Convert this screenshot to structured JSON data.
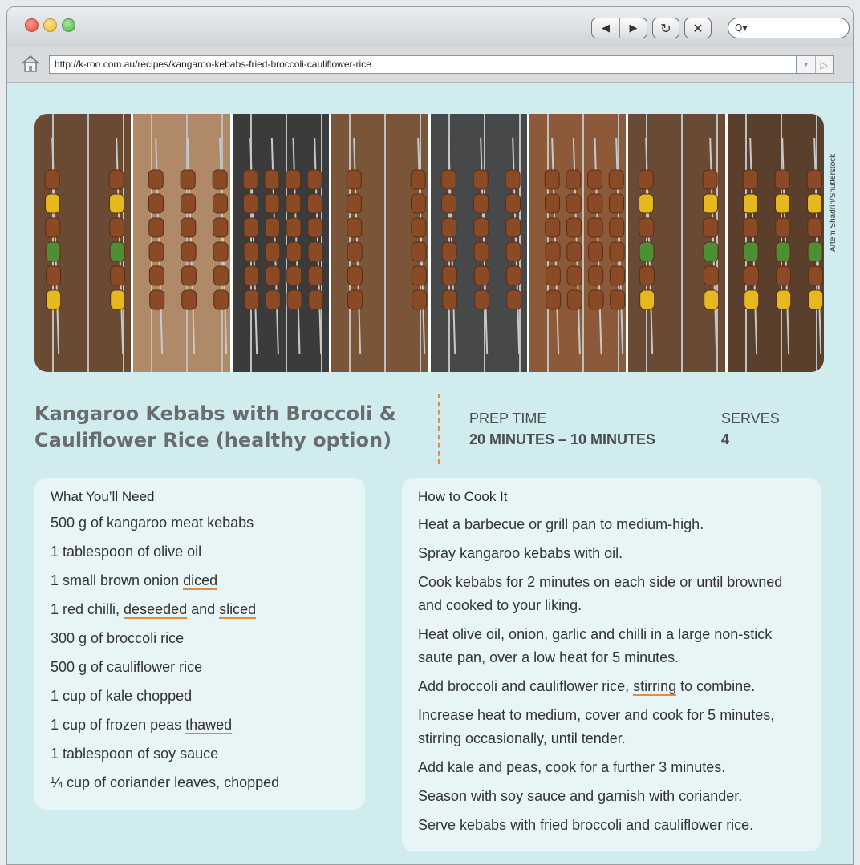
{
  "browser": {
    "url": "http://k-roo.com.au/recipes/kangaroo-kebabs-fried-broccoli-cauliflower-rice",
    "search_placeholder": "Q▾",
    "back_label": "◀",
    "forward_label": "▶",
    "reload_label": "↻",
    "stop_label": "✕",
    "url_dropdown_label": "▾",
    "url_go_label": "▷"
  },
  "banner": {
    "credit": "Artem Shadrin/Shutterstock",
    "panel_colors": [
      "#6b4a33",
      "#b08a68",
      "#3c3b3b",
      "#7a5538",
      "#46484a",
      "#8c5a38",
      "#6a4a34",
      "#5a3f2d"
    ]
  },
  "recipe": {
    "title": "Kangaroo Kebabs with Broccoli & Cauliflower Rice (healthy option)",
    "prep_label": "PREP TIME",
    "prep_value": "20 MINUTES – 10 MINUTES",
    "serves_label": "SERVES",
    "serves_value": "4"
  },
  "ingredients": {
    "heading": "What You’ll Need",
    "items": [
      [
        {
          "t": "500 g of kangaroo meat kebabs"
        }
      ],
      [
        {
          "t": "1 tablespoon of olive oil"
        }
      ],
      [
        {
          "t": "1 small brown onion "
        },
        {
          "t": "diced",
          "u": true
        }
      ],
      [
        {
          "t": "1 red chilli, "
        },
        {
          "t": "deseeded",
          "u": true
        },
        {
          "t": " and "
        },
        {
          "t": "sliced",
          "u": true
        }
      ],
      [
        {
          "t": "300 g of broccoli rice"
        }
      ],
      [
        {
          "t": "500 g of cauliflower rice"
        }
      ],
      [
        {
          "t": "1 cup of kale chopped"
        }
      ],
      [
        {
          "t": "1 cup of frozen peas "
        },
        {
          "t": "thawed",
          "u": true
        }
      ],
      [
        {
          "t": "1 tablespoon of soy sauce"
        }
      ],
      [
        {
          "t": "¼ cup of coriander leaves, chopped"
        }
      ]
    ]
  },
  "method": {
    "heading": "How to Cook It",
    "steps": [
      [
        {
          "t": "Heat a barbecue or grill pan to medium-high."
        }
      ],
      [
        {
          "t": "Spray kangaroo kebabs with oil."
        }
      ],
      [
        {
          "t": "Cook kebabs for 2 minutes on each side or until browned and cooked to your liking."
        }
      ],
      [
        {
          "t": "Heat olive oil, onion, garlic and chilli in a large non-stick saute pan, over a low heat for 5 minutes."
        }
      ],
      [
        {
          "t": "Add broccoli and cauliflower rice, "
        },
        {
          "t": "stirring",
          "u": true
        },
        {
          "t": " to combine."
        }
      ],
      [
        {
          "t": "Increase heat to medium, cover and cook for 5 minutes, stirring occasionally, until tender."
        }
      ],
      [
        {
          "t": "Add kale and peas, cook for a further 3 minutes."
        }
      ],
      [
        {
          "t": "Season with soy sauce and garnish with coriander."
        }
      ],
      [
        {
          "t": "Serve kebabs with fried broccoli and cauliflower rice."
        }
      ]
    ]
  },
  "colors": {
    "page_bg": "#d1ecee",
    "card_bg": "#e8f5f6",
    "accent_underline": "#e88a3c",
    "title_text": "#6a6d70"
  }
}
